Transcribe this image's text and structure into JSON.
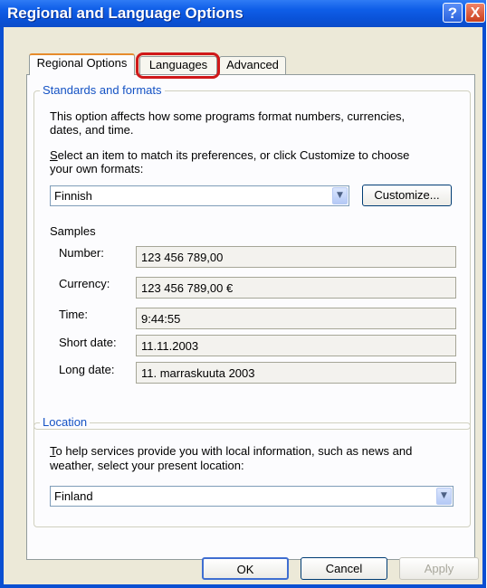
{
  "window": {
    "title": "Regional and Language Options",
    "help_glyph": "?",
    "close_glyph": "X"
  },
  "tabs": [
    {
      "label": "Regional Options",
      "selected": true
    },
    {
      "label": "Languages",
      "selected": false,
      "highlighted": true
    },
    {
      "label": "Advanced",
      "selected": false
    }
  ],
  "standards": {
    "legend": "Standards and formats",
    "description": [
      "This option affects how some programs format numbers, currencies,",
      "dates, and time."
    ],
    "instruction_lines": [
      "elect an item to match its preferences, or click Customize to choose",
      "your own formats:"
    ],
    "instruction_access_key": "S",
    "format_value": "Finnish",
    "customize_label": "Customize...",
    "samples_label": "Samples",
    "samples": [
      {
        "label": "Number:",
        "value": "123 456 789,00"
      },
      {
        "label": "Currency:",
        "value": "123 456 789,00 €"
      },
      {
        "label": "Time:",
        "value": "9:44:55"
      },
      {
        "label": "Short date:",
        "value": "11.11.2003"
      },
      {
        "label": "Long date:",
        "value": "11. marraskuuta 2003"
      }
    ]
  },
  "location": {
    "legend": "Location",
    "instruction_access_key": "T",
    "instruction_lines": [
      "o help services provide you with local information, such as news and",
      "weather, select your present location:"
    ],
    "value": "Finland"
  },
  "buttons": {
    "ok": "OK",
    "cancel": "Cancel",
    "apply": "Apply"
  },
  "colors": {
    "titlebar": "#0a52d8",
    "dialog_bg": "#ece9d8",
    "legend_text": "#1452c4",
    "highlight_ring": "#d01818"
  },
  "icons": {
    "help": "help-question-icon",
    "close": "close-x-icon",
    "dropdown": "chevron-down-icon"
  }
}
